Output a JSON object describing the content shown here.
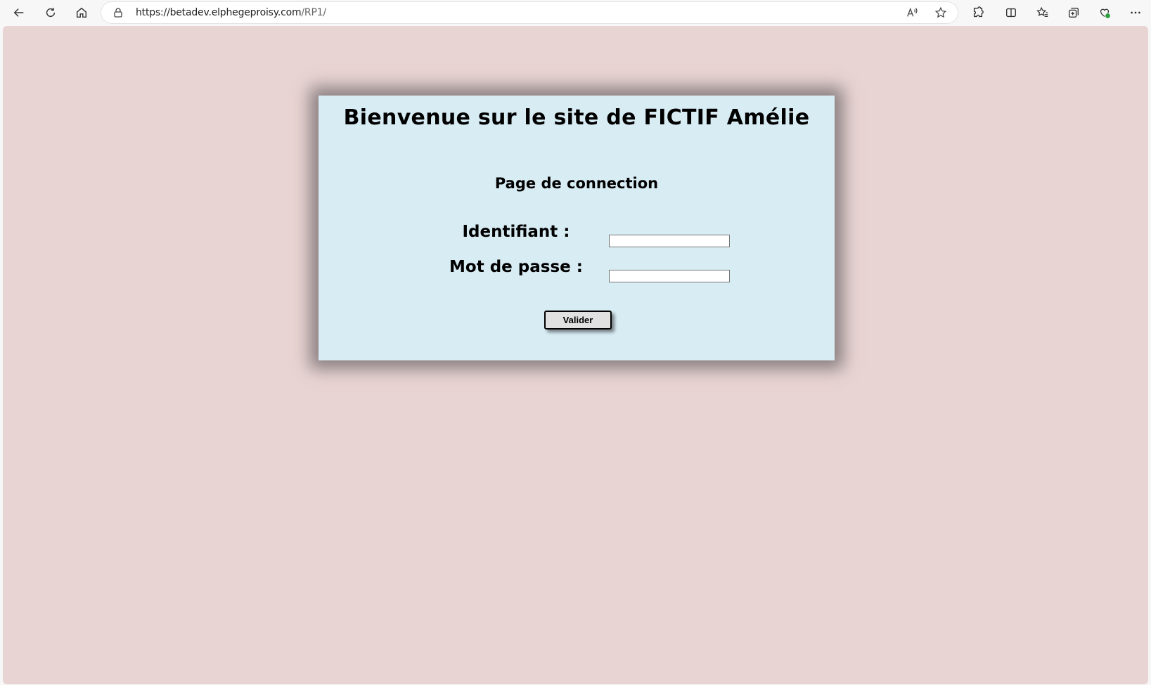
{
  "browser": {
    "url_host": "https://betadev.elphegeproisy.com",
    "url_path": "/RP1/",
    "icons": [
      "back-arrow-icon",
      "refresh-icon",
      "home-icon",
      "lock-icon",
      "read-aloud-icon",
      "favorite-star-icon",
      "extensions-icon",
      "split-screen-icon",
      "favorites-icon",
      "collections-icon",
      "browser-essentials-icon",
      "more-menu-icon"
    ]
  },
  "page": {
    "title": "Bienvenue sur le site de FICTIF Amélie",
    "subtitle": "Page de connection",
    "login_label": "Identifiant :",
    "password_label": "Mot de passe :",
    "login_value": "",
    "password_value": "",
    "submit_label": "Valider"
  },
  "colors": {
    "page_background": "#e8d4d3",
    "card_background": "#d8ecf4",
    "card_shadow": "#8a7f80"
  }
}
